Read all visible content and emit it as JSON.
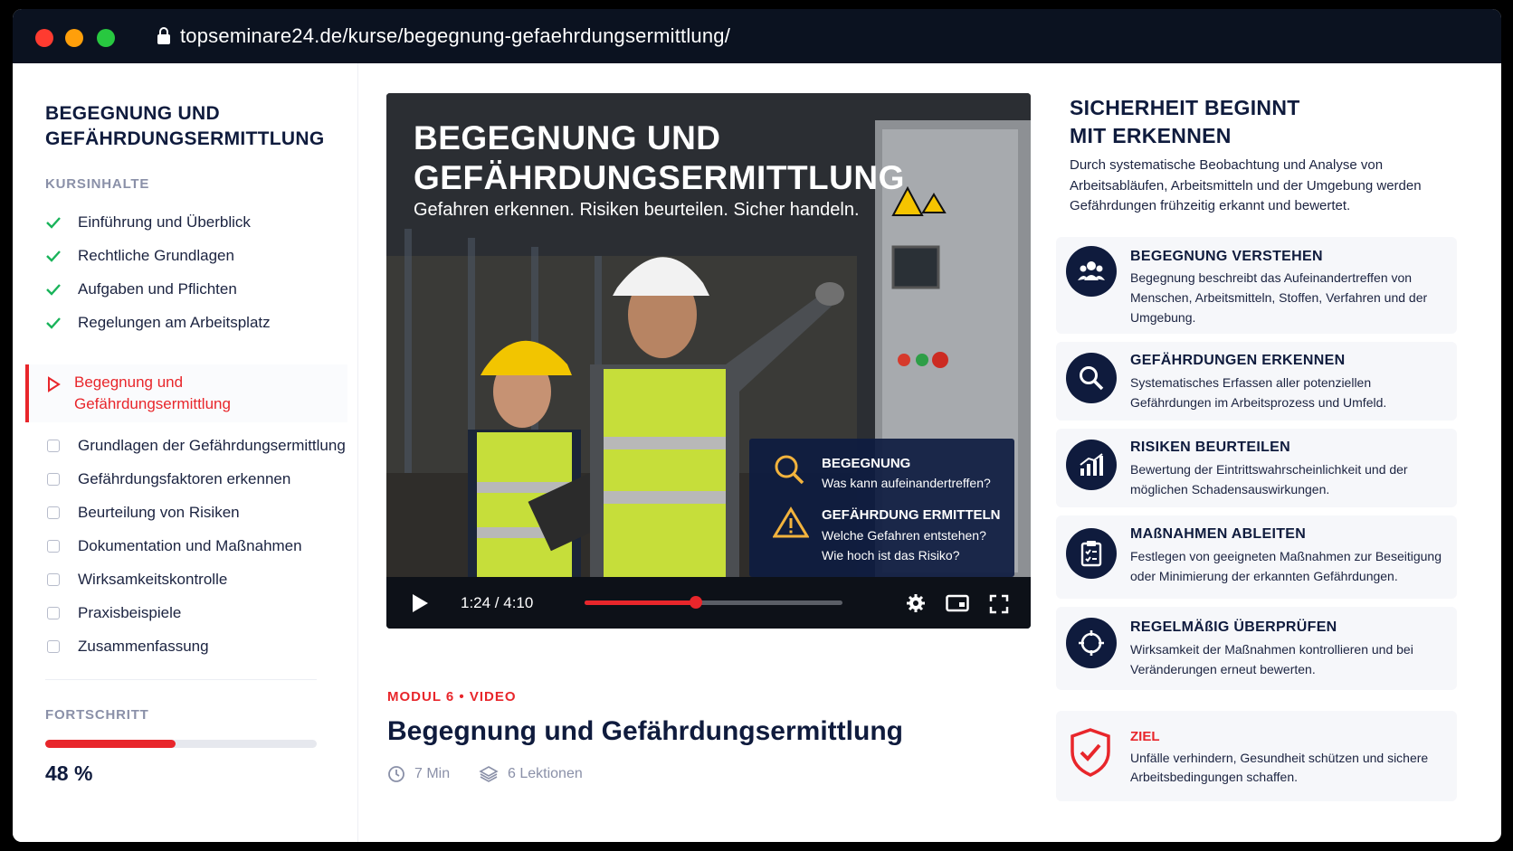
{
  "browser": {
    "url": "topseminare24.de/kurse/begegnung-gefaehrdungsermittlung/"
  },
  "sidebar": {
    "course_title": "BEGEGNUNG UND GEFÄHRDUNGSERMITTLUNG",
    "contents_label": "KURSINHALTE",
    "lessons": [
      {
        "label": "Einführung und Überblick",
        "status": "done"
      },
      {
        "label": "Rechtliche Grundlagen",
        "status": "done"
      },
      {
        "label": "Aufgaben und Pflichten",
        "status": "done"
      },
      {
        "label": "Regelungen am Arbeitsplatz",
        "status": "done"
      },
      {
        "label": "Begegnung und Gefährdungsermittlung",
        "status": "active"
      },
      {
        "label": "Grundlagen der Gefährdungsermittlung",
        "status": "open"
      },
      {
        "label": "Gefährdungsfaktoren erkennen",
        "status": "open"
      },
      {
        "label": "Beurteilung von Risiken",
        "status": "open"
      },
      {
        "label": "Dokumentation und Maßnahmen",
        "status": "open"
      },
      {
        "label": "Wirksamkeitskontrolle",
        "status": "open"
      },
      {
        "label": "Praxisbeispiele",
        "status": "open"
      },
      {
        "label": "Zusammenfassung",
        "status": "open"
      }
    ],
    "progress_label": "FORTSCHRITT",
    "progress_value": "48 %",
    "progress_fraction": 0.48
  },
  "video": {
    "title": "BEGEGNUNG UND GEFÄHRDUNGSERMITTLUNG",
    "subtitle": "Gefahren erkennen. Risiken beurteilen. Sicher handeln.",
    "overlay": {
      "item1_heading": "BEGEGNUNG",
      "item1_text": "Was kann aufeinandertreffen?",
      "item2_heading": "GEFÄHRDUNG ERMITTELN",
      "item2_text1": "Welche Gefahren entstehen?",
      "item2_text2": "Wie hoch ist das Risiko?"
    },
    "time": "1:24 / 4:10",
    "played_fraction": 0.43
  },
  "main": {
    "module_label": "MODUL 6 • VIDEO",
    "title": "Begegnung und Gefährdungsermittlung",
    "duration": "7 Min",
    "lessons_count": "6 Lektionen"
  },
  "right": {
    "title": "SICHERHEIT BEGINNT MIT ERKENNEN",
    "intro": "Durch systematische Beobachtung und Analyse von Arbeitsabläufen, Arbeitsmitteln und der Umgebung werden Gefährdungen frühzeitig erkannt und bewertet.",
    "cards": [
      {
        "heading": "BEGEGNUNG VERSTEHEN",
        "text": "Begegnung beschreibt das Aufeinandertreffen von Menschen, Arbeitsmitteln, Stoffen, Verfahren und der Umgebung.",
        "icon": "people-icon"
      },
      {
        "heading": "GEFÄHRDUNGEN ERKENNEN",
        "text": "Systematisches Erfassen aller potenziellen Gefährdungen im Arbeitsprozess und Umfeld.",
        "icon": "magnifier-icon"
      },
      {
        "heading": "RISIKEN BEURTEILEN",
        "text": "Bewertung der Eintrittswahrscheinlichkeit und der möglichen Schadensauswirkungen.",
        "icon": "chart-icon"
      },
      {
        "heading": "MAßNAHMEN ABLEITEN",
        "text": "Festlegen von geeigneten Maßnahmen zur Beseitigung oder Minimierung der erkannten Gefährdungen.",
        "icon": "clipboard-icon"
      },
      {
        "heading": "REGELMÄßIG ÜBERPRÜFEN",
        "text": "Wirksamkeit der Maßnahmen kontrollieren und bei Veränderungen erneut bewerten.",
        "icon": "refresh-icon"
      }
    ],
    "goal_heading": "ZIEL",
    "goal_text": "Unfälle verhindern, Gesundheit schützen und sichere Arbeitsbedingungen schaffen."
  },
  "colors": {
    "accent": "#e8262b",
    "navy": "#0f1b3d",
    "success": "#19b35a"
  }
}
